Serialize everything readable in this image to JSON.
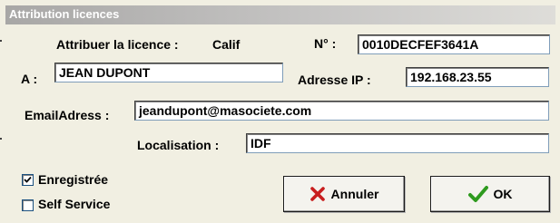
{
  "window": {
    "title": "Attribution licences"
  },
  "form": {
    "license_prefix": "Attribuer la licence :",
    "license_name": "Calif",
    "number_label": "N° :",
    "number_value": "0010DECFEF3641A",
    "to_label": "A :",
    "to_value": "JEAN DUPONT",
    "ip_label": "Adresse IP :",
    "ip_value": "192.168.23.55",
    "email_label": "EmailAdress :",
    "email_value": "jeandupont@masociete.com",
    "location_label": "Localisation :",
    "location_value": "IDF"
  },
  "options": {
    "registered_label": "Enregistrée",
    "registered_checked": true,
    "self_service_label": "Self Service",
    "self_service_checked": false
  },
  "buttons": {
    "cancel_label": "Annuler",
    "ok_label": "OK"
  }
}
